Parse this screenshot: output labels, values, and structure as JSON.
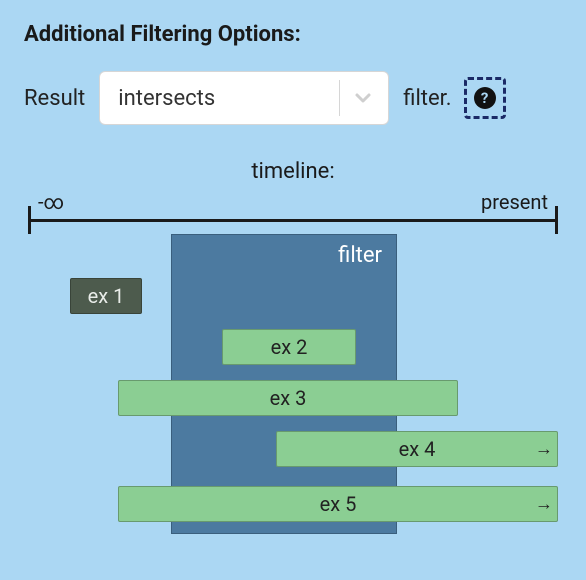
{
  "heading": "Additional Filtering Options:",
  "result_row": {
    "label_before": "Result",
    "select_value": "intersects",
    "label_after": "filter.",
    "help_text": "?"
  },
  "timeline": {
    "title": "timeline:",
    "left_label": "-∞",
    "right_label": "present",
    "filter_label": "filter"
  },
  "bars": {
    "ex1": "ex 1",
    "ex2": "ex 2",
    "ex3": "ex 3",
    "ex4": "ex 4",
    "ex5": "ex 5"
  },
  "arrow_glyph": "→"
}
